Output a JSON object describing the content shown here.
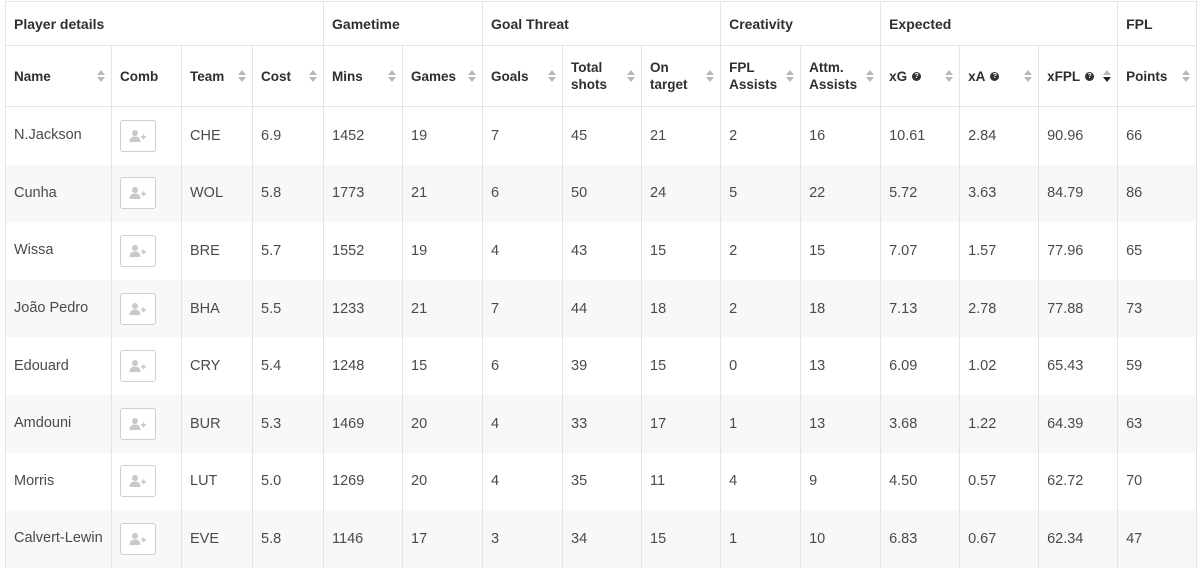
{
  "groups": [
    {
      "label": "Player details"
    },
    {
      "label": "Gametime"
    },
    {
      "label": "Goal Threat"
    },
    {
      "label": "Creativity"
    },
    {
      "label": "Expected"
    },
    {
      "label": "FPL"
    }
  ],
  "columns": {
    "name": "Name",
    "comb": "Comb",
    "team": "Team",
    "cost": "Cost",
    "mins": "Mins",
    "games": "Games",
    "goals": "Goals",
    "shots_1": "Total",
    "shots_2": "shots",
    "on_target_1": "On",
    "on_target_2": "target",
    "fpl_assists_1": "FPL",
    "fpl_assists_2": "Assists",
    "attm_assists_1": "Attm.",
    "attm_assists_2": "Assists",
    "xg": "xG",
    "xa": "xA",
    "xfpl": "xFPL",
    "points": "Points"
  },
  "active_sort": "xFPL descending",
  "comb_icon": "add-user-icon",
  "rows": [
    {
      "name": "N.Jackson",
      "team": "CHE",
      "cost": "6.9",
      "mins": "1452",
      "games": "19",
      "goals": "7",
      "shots": "45",
      "on_target": "21",
      "fpl_assists": "2",
      "attm_assists": "16",
      "xg": "10.61",
      "xa": "2.84",
      "xfpl": "90.96",
      "points": "66"
    },
    {
      "name": "Cunha",
      "team": "WOL",
      "cost": "5.8",
      "mins": "1773",
      "games": "21",
      "goals": "6",
      "shots": "50",
      "on_target": "24",
      "fpl_assists": "5",
      "attm_assists": "22",
      "xg": "5.72",
      "xa": "3.63",
      "xfpl": "84.79",
      "points": "86"
    },
    {
      "name": "Wissa",
      "team": "BRE",
      "cost": "5.7",
      "mins": "1552",
      "games": "19",
      "goals": "4",
      "shots": "43",
      "on_target": "15",
      "fpl_assists": "2",
      "attm_assists": "15",
      "xg": "7.07",
      "xa": "1.57",
      "xfpl": "77.96",
      "points": "65"
    },
    {
      "name": "João Pedro",
      "team": "BHA",
      "cost": "5.5",
      "mins": "1233",
      "games": "21",
      "goals": "7",
      "shots": "44",
      "on_target": "18",
      "fpl_assists": "2",
      "attm_assists": "18",
      "xg": "7.13",
      "xa": "2.78",
      "xfpl": "77.88",
      "points": "73"
    },
    {
      "name": "Edouard",
      "team": "CRY",
      "cost": "5.4",
      "mins": "1248",
      "games": "15",
      "goals": "6",
      "shots": "39",
      "on_target": "15",
      "fpl_assists": "0",
      "attm_assists": "13",
      "xg": "6.09",
      "xa": "1.02",
      "xfpl": "65.43",
      "points": "59"
    },
    {
      "name": "Amdouni",
      "team": "BUR",
      "cost": "5.3",
      "mins": "1469",
      "games": "20",
      "goals": "4",
      "shots": "33",
      "on_target": "17",
      "fpl_assists": "1",
      "attm_assists": "13",
      "xg": "3.68",
      "xa": "1.22",
      "xfpl": "64.39",
      "points": "63"
    },
    {
      "name": "Morris",
      "team": "LUT",
      "cost": "5.0",
      "mins": "1269",
      "games": "20",
      "goals": "4",
      "shots": "35",
      "on_target": "11",
      "fpl_assists": "4",
      "attm_assists": "9",
      "xg": "4.50",
      "xa": "0.57",
      "xfpl": "62.72",
      "points": "70"
    },
    {
      "name": "Calvert-Lewin",
      "team": "EVE",
      "cost": "5.8",
      "mins": "1146",
      "games": "17",
      "goals": "3",
      "shots": "34",
      "on_target": "15",
      "fpl_assists": "1",
      "attm_assists": "10",
      "xg": "6.83",
      "xa": "0.67",
      "xfpl": "62.34",
      "points": "47"
    }
  ]
}
